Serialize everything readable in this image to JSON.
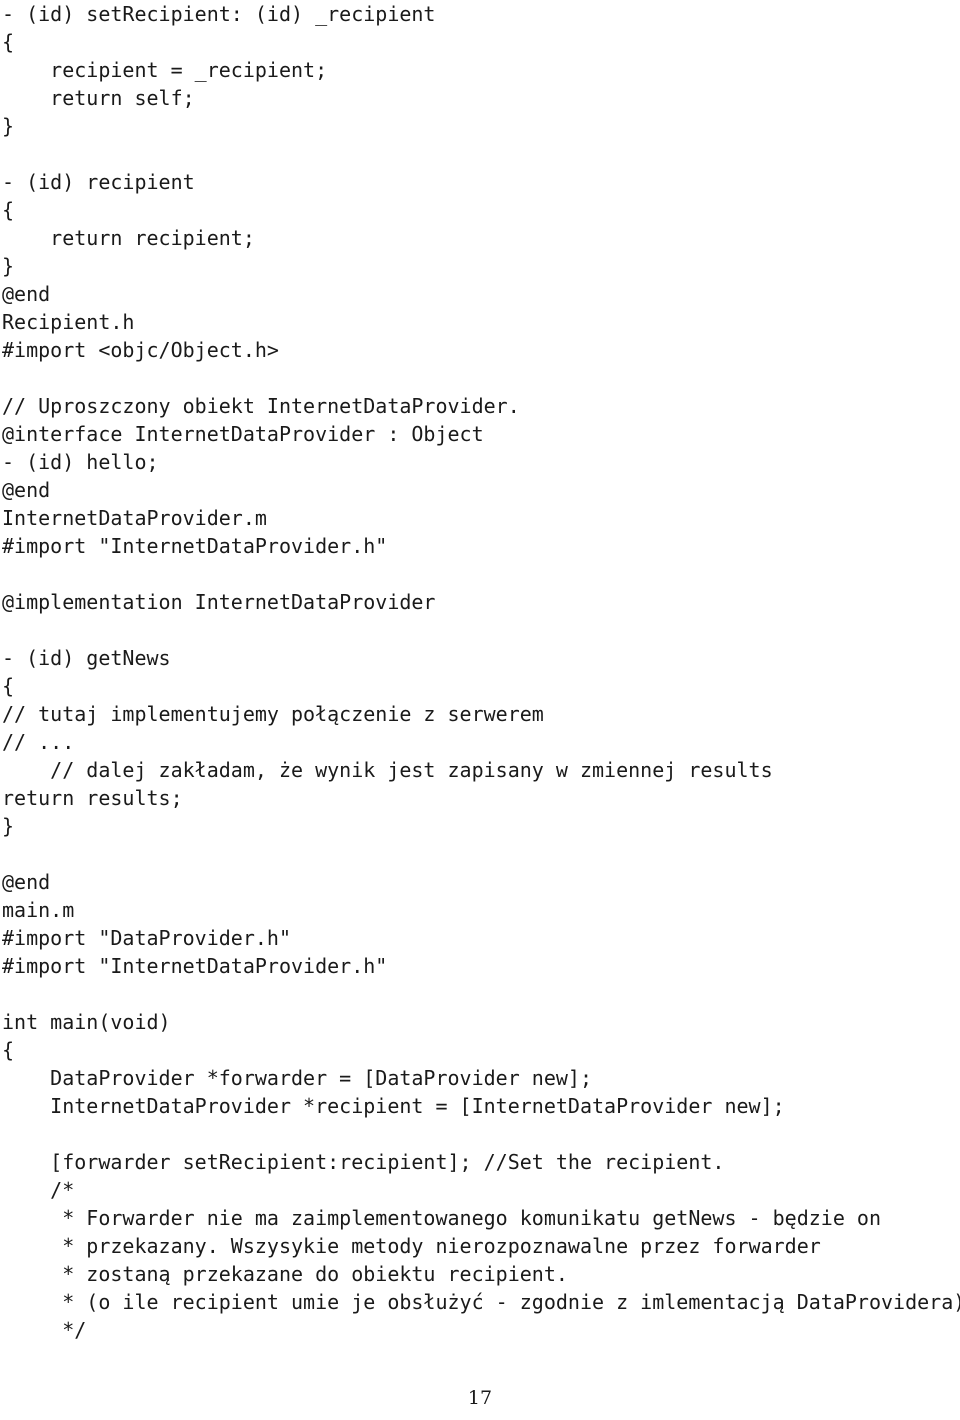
{
  "document": {
    "kind": "pdf-page",
    "language": "Objective-C listing with Polish comments",
    "page_number": "17",
    "text_color": "#1a1a1a",
    "background_color": "#ffffff"
  },
  "listing": {
    "lines": [
      "- (id) setRecipient: (id) _recipient",
      "{",
      "    recipient = _recipient;",
      "    return self;",
      "}",
      "",
      "- (id) recipient",
      "{",
      "    return recipient;",
      "}",
      "@end",
      "Recipient.h",
      "#import <objc/Object.h>",
      "",
      "// Uproszczony obiekt InternetDataProvider.",
      "@interface InternetDataProvider : Object",
      "- (id) hello;",
      "@end",
      "InternetDataProvider.m",
      "#import \"InternetDataProvider.h\"",
      "",
      "@implementation InternetDataProvider",
      "",
      "- (id) getNews",
      "{",
      "// tutaj implementujemy połączenie z serwerem",
      "// ...",
      "    // dalej zakładam, że wynik jest zapisany w zmiennej results",
      "return results;",
      "}",
      "",
      "@end",
      "main.m",
      "#import \"DataProvider.h\"",
      "#import \"InternetDataProvider.h\"",
      "",
      "int main(void)",
      "{",
      "    DataProvider *forwarder = [DataProvider new];",
      "    InternetDataProvider *recipient = [InternetDataProvider new];",
      "",
      "    [forwarder setRecipient:recipient]; //Set the recipient.",
      "    /*",
      "     * Forwarder nie ma zaimplementowanego komunikatu getNews - będzie on",
      "     * przekazany. Wszysykie metody nierozpoznawalne przez forwarder",
      "     * zostaną przekazane do obiektu recipient.",
      "     * (o ile recipient umie je obsłużyć - zgodnie z imlementacją DataProvidera)",
      "     */"
    ]
  }
}
